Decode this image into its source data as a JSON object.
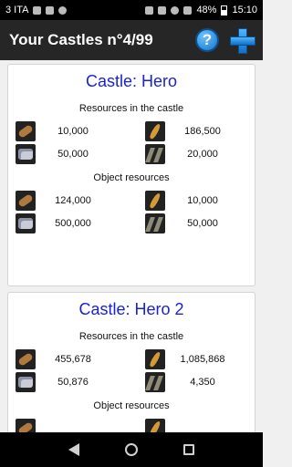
{
  "status_bar": {
    "carrier": "3 ITA",
    "battery": "48%",
    "time": "15:10"
  },
  "app_bar": {
    "title": "Your Castles n°4/99",
    "help_label": "?"
  },
  "castles": [
    {
      "name": "Castle: Hero",
      "castle_resources_title": "Resources in the castle",
      "castle_resources": {
        "wood": "10,000",
        "food": "186,500",
        "stone": "50,000",
        "iron": "20,000"
      },
      "object_resources_title": "Object resources",
      "object_resources": {
        "wood": "124,000",
        "food": "10,000",
        "stone": "500,000",
        "iron": "50,000"
      }
    },
    {
      "name": "Castle: Hero 2",
      "castle_resources_title": "Resources in the castle",
      "castle_resources": {
        "wood": "455,678",
        "food": "1,085,868",
        "stone": "50,876",
        "iron": "4,350"
      },
      "object_resources_title": "Object resources"
    }
  ],
  "icons": {
    "wood": "wood-log-icon",
    "food": "wheat-icon",
    "stone": "stone-icon",
    "iron": "iron-bars-icon"
  }
}
